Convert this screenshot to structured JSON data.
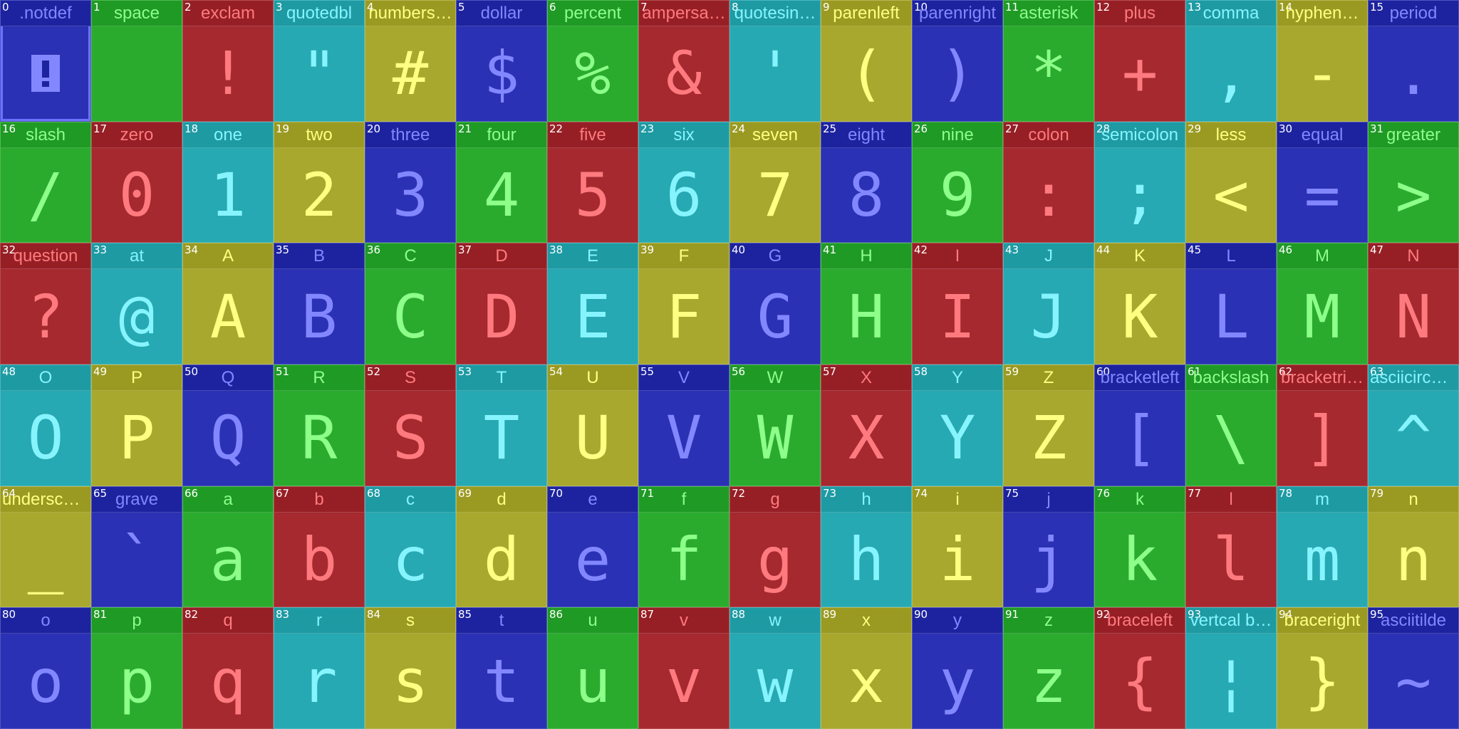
{
  "glyphs": [
    {
      "index": "0",
      "name": ".notdef",
      "char": "",
      "color": "blue",
      "notdef": true
    },
    {
      "index": "1",
      "name": "space",
      "char": " ",
      "color": "green"
    },
    {
      "index": "2",
      "name": "exclam",
      "char": "!",
      "color": "red"
    },
    {
      "index": "3",
      "name": "quotedbl",
      "char": "\"",
      "color": "cyan"
    },
    {
      "index": "4",
      "name": "numbers…",
      "char": "#",
      "color": "yellow"
    },
    {
      "index": "5",
      "name": "dollar",
      "char": "$",
      "color": "blue"
    },
    {
      "index": "6",
      "name": "percent",
      "char": "%",
      "color": "green"
    },
    {
      "index": "7",
      "name": "ampersa…",
      "char": "&",
      "color": "red"
    },
    {
      "index": "8",
      "name": "quotesin…",
      "char": "'",
      "color": "cyan"
    },
    {
      "index": "9",
      "name": "parenleft",
      "char": "(",
      "color": "yellow"
    },
    {
      "index": "10",
      "name": "parenright",
      "char": ")",
      "color": "blue"
    },
    {
      "index": "11",
      "name": "asterisk",
      "char": "*",
      "color": "green"
    },
    {
      "index": "12",
      "name": "plus",
      "char": "+",
      "color": "red"
    },
    {
      "index": "13",
      "name": "comma",
      "char": ",",
      "color": "cyan"
    },
    {
      "index": "14",
      "name": "hyphen…",
      "char": "-",
      "color": "yellow"
    },
    {
      "index": "15",
      "name": "period",
      "char": ".",
      "color": "blue"
    },
    {
      "index": "16",
      "name": "slash",
      "char": "/",
      "color": "green"
    },
    {
      "index": "17",
      "name": "zero",
      "char": "0",
      "color": "red"
    },
    {
      "index": "18",
      "name": "one",
      "char": "1",
      "color": "cyan"
    },
    {
      "index": "19",
      "name": "two",
      "char": "2",
      "color": "yellow"
    },
    {
      "index": "20",
      "name": "three",
      "char": "3",
      "color": "blue"
    },
    {
      "index": "21",
      "name": "four",
      "char": "4",
      "color": "green"
    },
    {
      "index": "22",
      "name": "five",
      "char": "5",
      "color": "red"
    },
    {
      "index": "23",
      "name": "six",
      "char": "6",
      "color": "cyan"
    },
    {
      "index": "24",
      "name": "seven",
      "char": "7",
      "color": "yellow"
    },
    {
      "index": "25",
      "name": "eight",
      "char": "8",
      "color": "blue"
    },
    {
      "index": "26",
      "name": "nine",
      "char": "9",
      "color": "green"
    },
    {
      "index": "27",
      "name": "colon",
      "char": ":",
      "color": "red"
    },
    {
      "index": "28",
      "name": "semicolon",
      "char": ";",
      "color": "cyan"
    },
    {
      "index": "29",
      "name": "less",
      "char": "<",
      "color": "yellow"
    },
    {
      "index": "30",
      "name": "equal",
      "char": "=",
      "color": "blue"
    },
    {
      "index": "31",
      "name": "greater",
      "char": ">",
      "color": "green"
    },
    {
      "index": "32",
      "name": "question",
      "char": "?",
      "color": "red"
    },
    {
      "index": "33",
      "name": "at",
      "char": "@",
      "color": "cyan"
    },
    {
      "index": "34",
      "name": "A",
      "char": "A",
      "color": "yellow"
    },
    {
      "index": "35",
      "name": "B",
      "char": "B",
      "color": "blue"
    },
    {
      "index": "36",
      "name": "C",
      "char": "C",
      "color": "green"
    },
    {
      "index": "37",
      "name": "D",
      "char": "D",
      "color": "red"
    },
    {
      "index": "38",
      "name": "E",
      "char": "E",
      "color": "cyan"
    },
    {
      "index": "39",
      "name": "F",
      "char": "F",
      "color": "yellow"
    },
    {
      "index": "40",
      "name": "G",
      "char": "G",
      "color": "blue"
    },
    {
      "index": "41",
      "name": "H",
      "char": "H",
      "color": "green"
    },
    {
      "index": "42",
      "name": "I",
      "char": "I",
      "color": "red"
    },
    {
      "index": "43",
      "name": "J",
      "char": "J",
      "color": "cyan"
    },
    {
      "index": "44",
      "name": "K",
      "char": "K",
      "color": "yellow"
    },
    {
      "index": "45",
      "name": "L",
      "char": "L",
      "color": "blue"
    },
    {
      "index": "46",
      "name": "M",
      "char": "M",
      "color": "green"
    },
    {
      "index": "47",
      "name": "N",
      "char": "N",
      "color": "red"
    },
    {
      "index": "48",
      "name": "O",
      "char": "O",
      "color": "cyan"
    },
    {
      "index": "49",
      "name": "P",
      "char": "P",
      "color": "yellow"
    },
    {
      "index": "50",
      "name": "Q",
      "char": "Q",
      "color": "blue"
    },
    {
      "index": "51",
      "name": "R",
      "char": "R",
      "color": "green"
    },
    {
      "index": "52",
      "name": "S",
      "char": "S",
      "color": "red"
    },
    {
      "index": "53",
      "name": "T",
      "char": "T",
      "color": "cyan"
    },
    {
      "index": "54",
      "name": "U",
      "char": "U",
      "color": "yellow"
    },
    {
      "index": "55",
      "name": "V",
      "char": "V",
      "color": "blue"
    },
    {
      "index": "56",
      "name": "W",
      "char": "W",
      "color": "green"
    },
    {
      "index": "57",
      "name": "X",
      "char": "X",
      "color": "red"
    },
    {
      "index": "58",
      "name": "Y",
      "char": "Y",
      "color": "cyan"
    },
    {
      "index": "59",
      "name": "Z",
      "char": "Z",
      "color": "yellow"
    },
    {
      "index": "60",
      "name": "bracketleft",
      "char": "[",
      "color": "blue"
    },
    {
      "index": "61",
      "name": "backslash",
      "char": "\\",
      "color": "green"
    },
    {
      "index": "62",
      "name": "bracketri…",
      "char": "]",
      "color": "red"
    },
    {
      "index": "63",
      "name": "asciicircu…",
      "char": "^",
      "color": "cyan"
    },
    {
      "index": "64",
      "name": "undersco…",
      "char": "_",
      "color": "yellow"
    },
    {
      "index": "65",
      "name": "grave",
      "char": "`",
      "color": "blue"
    },
    {
      "index": "66",
      "name": "a",
      "char": "a",
      "color": "green"
    },
    {
      "index": "67",
      "name": "b",
      "char": "b",
      "color": "red"
    },
    {
      "index": "68",
      "name": "c",
      "char": "c",
      "color": "cyan"
    },
    {
      "index": "69",
      "name": "d",
      "char": "d",
      "color": "yellow"
    },
    {
      "index": "70",
      "name": "e",
      "char": "e",
      "color": "blue"
    },
    {
      "index": "71",
      "name": "f",
      "char": "f",
      "color": "green"
    },
    {
      "index": "72",
      "name": "g",
      "char": "g",
      "color": "red"
    },
    {
      "index": "73",
      "name": "h",
      "char": "h",
      "color": "cyan"
    },
    {
      "index": "74",
      "name": "i",
      "char": "i",
      "color": "yellow"
    },
    {
      "index": "75",
      "name": "j",
      "char": "j",
      "color": "blue"
    },
    {
      "index": "76",
      "name": "k",
      "char": "k",
      "color": "green"
    },
    {
      "index": "77",
      "name": "l",
      "char": "l",
      "color": "red"
    },
    {
      "index": "78",
      "name": "m",
      "char": "m",
      "color": "cyan"
    },
    {
      "index": "79",
      "name": "n",
      "char": "n",
      "color": "yellow"
    },
    {
      "index": "80",
      "name": "o",
      "char": "o",
      "color": "blue"
    },
    {
      "index": "81",
      "name": "p",
      "char": "p",
      "color": "green"
    },
    {
      "index": "82",
      "name": "q",
      "char": "q",
      "color": "red"
    },
    {
      "index": "83",
      "name": "r",
      "char": "r",
      "color": "cyan"
    },
    {
      "index": "84",
      "name": "s",
      "char": "s",
      "color": "yellow"
    },
    {
      "index": "85",
      "name": "t",
      "char": "t",
      "color": "blue"
    },
    {
      "index": "86",
      "name": "u",
      "char": "u",
      "color": "green"
    },
    {
      "index": "87",
      "name": "v",
      "char": "v",
      "color": "red"
    },
    {
      "index": "88",
      "name": "w",
      "char": "w",
      "color": "cyan"
    },
    {
      "index": "89",
      "name": "x",
      "char": "x",
      "color": "yellow"
    },
    {
      "index": "90",
      "name": "y",
      "char": "y",
      "color": "blue"
    },
    {
      "index": "91",
      "name": "z",
      "char": "z",
      "color": "green"
    },
    {
      "index": "92",
      "name": "braceleft",
      "char": "{",
      "color": "red"
    },
    {
      "index": "93",
      "name": "vertcal b…",
      "char": "¦",
      "color": "cyan"
    },
    {
      "index": "94",
      "name": "braceright",
      "char": "}",
      "color": "yellow"
    },
    {
      "index": "95",
      "name": "asciitilde",
      "char": "~",
      "color": "blue"
    }
  ],
  "selected_index": "0",
  "theme_colors": {
    "blue": "#2a31b4",
    "green": "#2aab2e",
    "red": "#a5292f",
    "cyan": "#26a9b2",
    "yellow": "#a8a82e"
  }
}
